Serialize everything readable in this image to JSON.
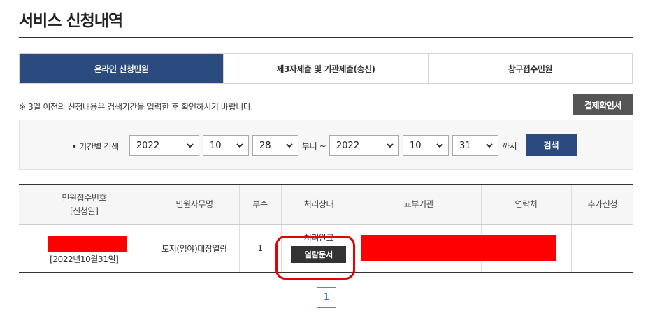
{
  "page": {
    "title": "서비스 신청내역"
  },
  "tabs": [
    {
      "label": "온라인 신청민원",
      "active": true
    },
    {
      "label": "제3자제출 및 기관제출(송신)",
      "active": false
    },
    {
      "label": "창구접수민원",
      "active": false
    }
  ],
  "notice": {
    "text": "※ 3일 이전의 신청내용은 검색기간을 입력한 후 확인하시기 바랍니다."
  },
  "confirm_button": {
    "label": "결제확인서"
  },
  "search": {
    "label": "• 기간별 검색",
    "from": {
      "year": "2022",
      "month": "10",
      "day": "28"
    },
    "from_suffix": "부터 ~",
    "to": {
      "year": "2022",
      "month": "10",
      "day": "31"
    },
    "to_suffix": "까지",
    "button_label": "검색"
  },
  "table": {
    "headers": {
      "receipt_no": "민원접수번호",
      "receipt_no_sub": "[신청일]",
      "service_name": "민원사무명",
      "copies": "부수",
      "status": "처리상태",
      "agency": "교부기관",
      "contact": "연락처",
      "extra": "추가신청"
    },
    "rows": [
      {
        "date": "[2022년10월31일]",
        "service_name": "토지(임야)대장열람",
        "copies": "1",
        "status": "처리완료",
        "action_label": "열람문서"
      }
    ]
  },
  "pagination": {
    "current": "1"
  },
  "colors": {
    "primary": "#2b4a7e",
    "redaction": "#ff0000",
    "highlight": "#e60000"
  }
}
